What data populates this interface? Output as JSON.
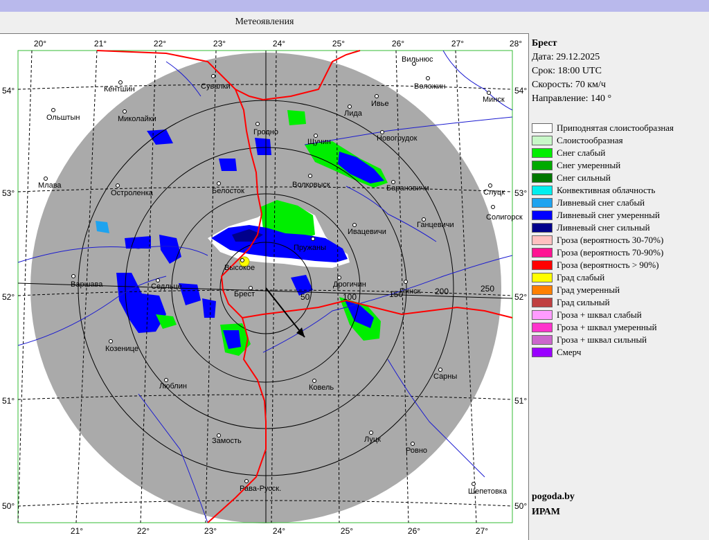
{
  "header": {
    "title": "Метеоявления"
  },
  "station": {
    "name": "Брест",
    "date": "Дата: 29.12.2025",
    "time": "Срок: 18:00 UTC",
    "speed": "Скорость: 70  км/ч",
    "direction": "Направление: 140 °"
  },
  "legend": [
    {
      "label": "Приподнятая слоистообразная",
      "color": "#ffffff"
    },
    {
      "label": "Слоистообразная",
      "color": "#c8f7c8"
    },
    {
      "label": "Снег слабый",
      "color": "#00ee00"
    },
    {
      "label": "Снег умеренный",
      "color": "#00aa00"
    },
    {
      "label": "Снег сильный",
      "color": "#007700"
    },
    {
      "label": "Конвективная облачность",
      "color": "#00eeee"
    },
    {
      "label": "Ливневый снег слабый",
      "color": "#1ea3ef"
    },
    {
      "label": "Ливневый снег умеренный",
      "color": "#0000ff"
    },
    {
      "label": "Ливневый снег сильный",
      "color": "#00008b"
    },
    {
      "label": "Гроза (вероятность 30-70%)",
      "color": "#ffc0c0"
    },
    {
      "label": "Гроза (вероятность 70-90%)",
      "color": "#ff1493"
    },
    {
      "label": "Гроза (вероятность > 90%)",
      "color": "#ff0000"
    },
    {
      "label": "Град слабый",
      "color": "#ffff00"
    },
    {
      "label": "Град умеренный",
      "color": "#ff8000"
    },
    {
      "label": "Град сильный",
      "color": "#c04040"
    },
    {
      "label": "Гроза + шквал слабый",
      "color": "#ff9cff"
    },
    {
      "label": "Гроза + шквал умеренный",
      "color": "#ff33cc"
    },
    {
      "label": "Гроза + шквал сильный",
      "color": "#cc66cc"
    },
    {
      "label": "Смерч",
      "color": "#9900ff"
    }
  ],
  "credits": {
    "site": "pogoda.by",
    "org": "ИРАМ"
  },
  "map": {
    "lon_labels_top": [
      "20°",
      "21°",
      "22°",
      "23°",
      "24°",
      "25°",
      "26°",
      "27°",
      "28°"
    ],
    "lon_labels_bottom": [
      "21°",
      "22°",
      "23°",
      "24°",
      "25°",
      "26°",
      "27°"
    ],
    "lat_labels_left": [
      "54°",
      "53°",
      "52°",
      "51°",
      "50°"
    ],
    "lat_labels_right": [
      "54°",
      "53°",
      "52°",
      "51°",
      "50°"
    ],
    "range_labels": [
      "50",
      "100",
      "150",
      "200",
      "250"
    ],
    "cities": [
      "Кентшин",
      "Сувалки",
      "Вильнюс",
      "Воложин",
      "Минск",
      "Ольштын",
      "Миколайки",
      "Ивье",
      "Лида",
      "Гродно",
      "Новогрудок",
      "Щучин",
      "Млава",
      "Остроленка",
      "Белосток",
      "Волковыск",
      "Барановичи",
      "Слуцк",
      "Солигорск",
      "Ганцевичи",
      "Ивацевичи",
      "Пружаны",
      "Высокое",
      "Варшава",
      "Седльце",
      "Брест",
      "Дрогичин",
      "Пинск",
      "Козенице",
      "Люблин",
      "Ковель",
      "Сарны",
      "Замость",
      "Луцк",
      "Ровно",
      "Рава-Русск.",
      "Шепетовка"
    ]
  },
  "colors": {
    "radar_disk": "#aaaaaa",
    "border": "#ff0000",
    "river": "#0000cc",
    "grid": "#000000"
  }
}
